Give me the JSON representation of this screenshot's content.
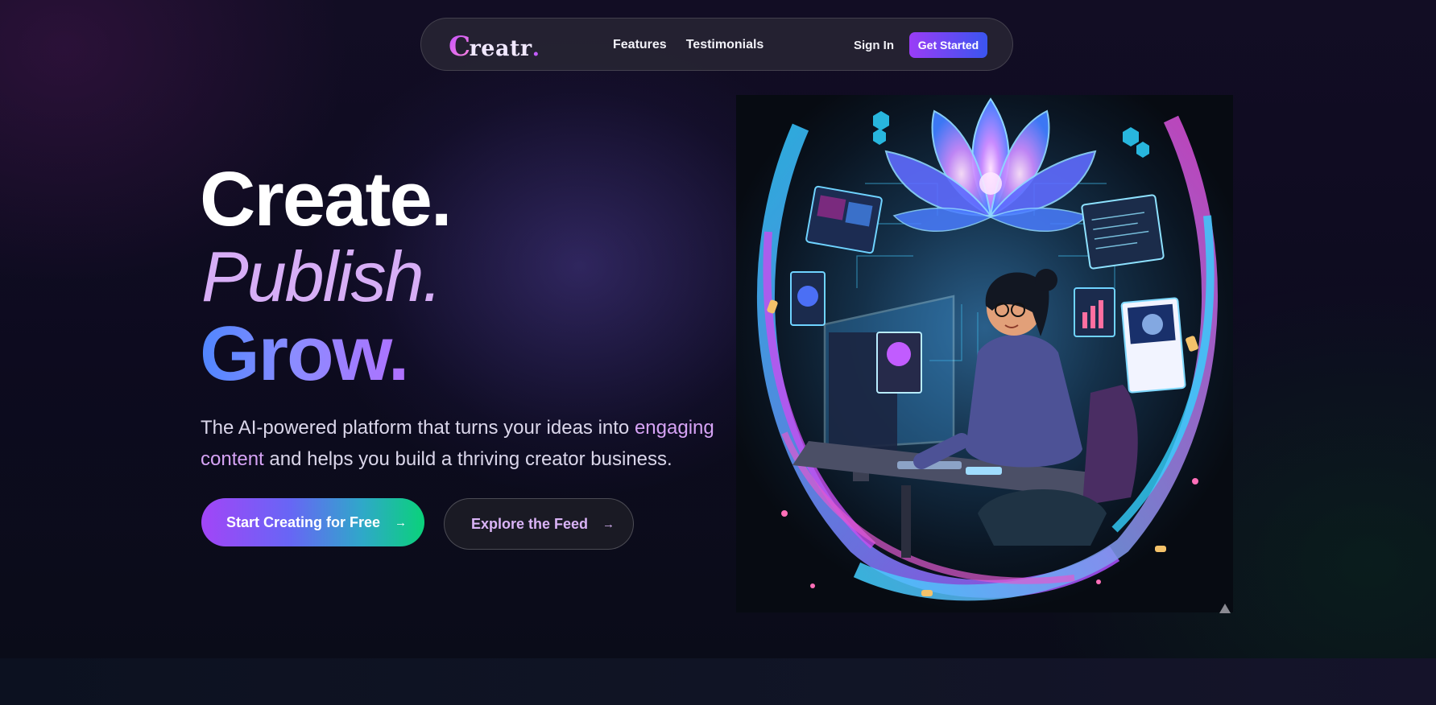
{
  "nav": {
    "logo_initial": "C",
    "logo_rest": "reatr",
    "logo_dot": ".",
    "links": [
      "Features",
      "Testimonials"
    ],
    "sign_in": "Sign In",
    "get_started": "Get Started"
  },
  "hero": {
    "line1": "Create.",
    "line2": "Publish.",
    "line3": "Grow.",
    "subtitle_part1": "The AI-powered platform that turns your ideas into ",
    "subtitle_highlight": "engaging content",
    "subtitle_part2": " and helps you build a thriving creator business.",
    "cta_primary": "Start Creating for Free",
    "cta_secondary": "Explore the Feed",
    "arrow_icon": "arrow-right-icon"
  },
  "colors": {
    "background": "#0c0a1c",
    "accent_purple": "#9a3cf6",
    "accent_blue": "#3a55f0",
    "accent_green": "#0ad27a",
    "publish_color": "#d7aef6"
  }
}
